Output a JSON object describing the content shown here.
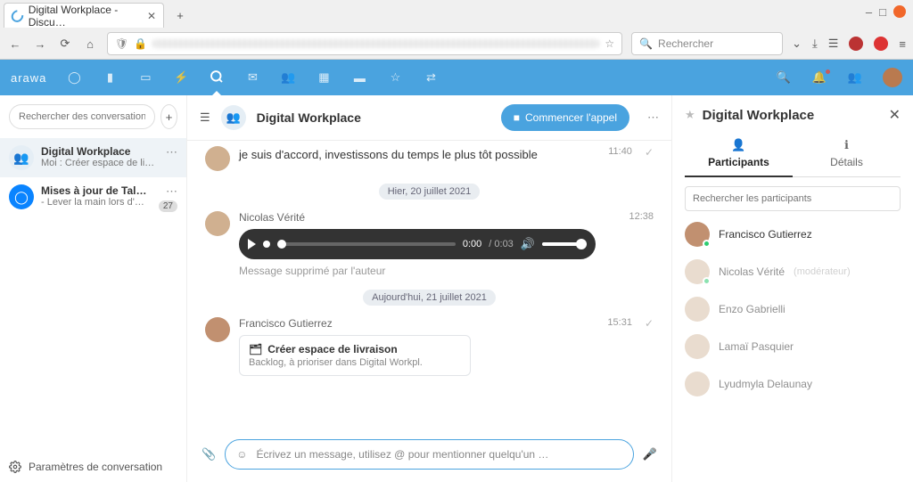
{
  "browser": {
    "tab_title": "Digital Workplace - Discu…",
    "new_tab": "+",
    "search_placeholder": "Rechercher",
    "star": "☆",
    "shield": "🛡",
    "lock": "🔒"
  },
  "window_controls": {
    "min": "–",
    "max": "□"
  },
  "brand": "arawa",
  "nav_icons": [
    "○",
    "📁",
    "🖼",
    "⚡",
    "○",
    "✉",
    "👥",
    "📅",
    "💼",
    "⭐",
    "⇄"
  ],
  "nav_active_index": 4,
  "nav_right": {
    "search": "🔍",
    "bell": "🔔",
    "contacts": "👥"
  },
  "conversations": {
    "search_placeholder": "Rechercher des conversations ou de",
    "new_conv": "+",
    "items": [
      {
        "title": "Digital Workplace",
        "subtitle": "Moi : Créer espace de livraison",
        "active": true,
        "av": "users"
      },
      {
        "title": "Mises à jour de Talk ✅",
        "subtitle": "- Lever la main lors d'u…",
        "active": false,
        "av": "ring",
        "badge": "27"
      }
    ],
    "settings": "Paramètres de conversation"
  },
  "chat": {
    "room_title": "Digital Workplace",
    "call_label": "Commencer l'appel",
    "prev_msg": {
      "text": "je suis d'accord, investissons du temps le plus tôt possible",
      "time": "11:40"
    },
    "sep1": "Hier, 20 juillet 2021",
    "msg_audio": {
      "author": "Nicolas Vérité",
      "time": "12:38",
      "cur": "0:00",
      "dur": "0:03"
    },
    "deleted": "Message supprimé par l'auteur",
    "sep2": "Aujourd'hui, 21 juillet 2021",
    "msg_card": {
      "author": "Francisco Gutierrez",
      "time": "15:31",
      "card_title": "Créer espace de livraison",
      "card_sub": "Backlog, à prioriser dans Digital Workpl."
    },
    "composer_placeholder": "Écrivez un message, utilisez @ pour mentionner quelqu'un …"
  },
  "right": {
    "title": "Digital Workplace",
    "tabs": {
      "participants": "Participants",
      "details": "Détails"
    },
    "search_placeholder": "Rechercher les participants",
    "participants": [
      {
        "name": "Francisco Gutierrez",
        "online": true,
        "dim": false,
        "mod": ""
      },
      {
        "name": "Nicolas Vérité",
        "online": true,
        "dim": true,
        "mod": "(modérateur)"
      },
      {
        "name": "Enzo Gabrielli",
        "online": false,
        "dim": true,
        "mod": ""
      },
      {
        "name": "Lamaï Pasquier",
        "online": false,
        "dim": true,
        "mod": ""
      },
      {
        "name": "Lyudmyla Delaunay",
        "online": false,
        "dim": true,
        "mod": ""
      }
    ]
  },
  "colors": {
    "accent": "#4aa3df"
  }
}
